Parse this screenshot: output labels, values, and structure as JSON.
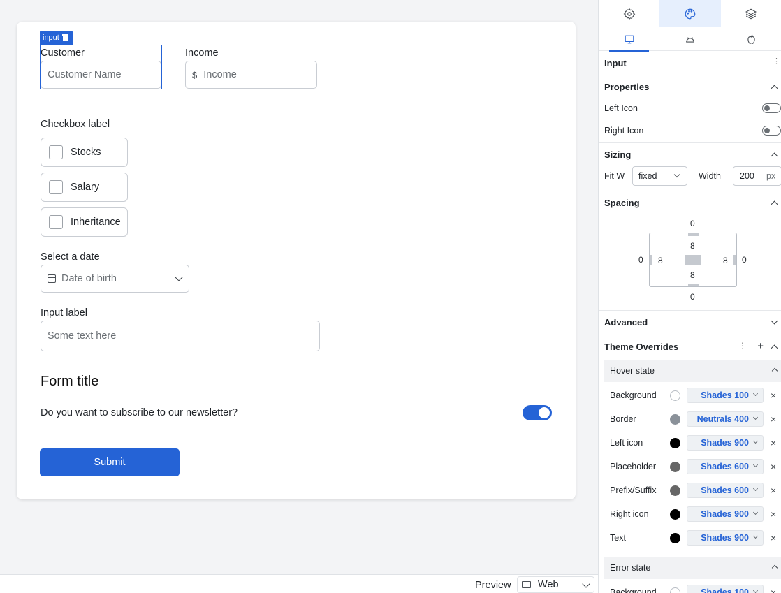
{
  "form": {
    "selection_tag": "input",
    "customer_label": "Customer",
    "customer_placeholder": "Customer Name",
    "income_label": "Income",
    "income_prefix": "$",
    "income_placeholder": "Income",
    "checkbox_group_label": "Checkbox label",
    "checkboxes": [
      {
        "label": "Stocks",
        "checked": false
      },
      {
        "label": "Salary",
        "checked": false
      },
      {
        "label": "Inheritance",
        "checked": false
      }
    ],
    "date_label": "Select a date",
    "date_placeholder": "Date of birth",
    "input_label": "Input label",
    "input_placeholder": "Some text here",
    "form_title": "Form title",
    "newsletter_question": "Do you want to subscribe to our newsletter?",
    "newsletter_on": true,
    "submit_label": "Submit"
  },
  "bottom_bar": {
    "preview_label": "Preview",
    "device": "Web"
  },
  "panel": {
    "top_tabs": [
      "settings-icon",
      "palette-icon",
      "layers-icon"
    ],
    "active_top_tab": 1,
    "device_tabs": [
      "desktop-icon",
      "android-icon",
      "apple-icon"
    ],
    "active_device_tab": 0,
    "component_name": "Input",
    "properties": {
      "title": "Properties",
      "left_icon_label": "Left Icon",
      "left_icon_on": false,
      "right_icon_label": "Right Icon",
      "right_icon_on": false
    },
    "sizing": {
      "title": "Sizing",
      "fit_label": "Fit W",
      "fit_value": "fixed",
      "width_label": "Width",
      "width_value": "200",
      "width_unit": "px"
    },
    "spacing": {
      "title": "Spacing",
      "margin_top": "0",
      "margin_right": "0",
      "margin_bottom": "0",
      "margin_left": "0",
      "padding_top": "8",
      "padding_right": "8",
      "padding_bottom": "8",
      "padding_left": "8"
    },
    "advanced_title": "Advanced",
    "theme_overrides_title": "Theme Overrides",
    "hover_state": {
      "title": "Hover state",
      "rows": [
        {
          "name": "Background",
          "color": "#ffffff",
          "value": "Shades 100"
        },
        {
          "name": "Border",
          "color": "#8a9199",
          "value": "Neutrals 400"
        },
        {
          "name": "Left icon",
          "color": "#000000",
          "value": "Shades 900"
        },
        {
          "name": "Placeholder",
          "color": "#666666",
          "value": "Shades 600"
        },
        {
          "name": "Prefix/Suffix",
          "color": "#666666",
          "value": "Shades 600"
        },
        {
          "name": "Right icon",
          "color": "#000000",
          "value": "Shades 900"
        },
        {
          "name": "Text",
          "color": "#000000",
          "value": "Shades 900"
        }
      ]
    },
    "error_state": {
      "title": "Error state",
      "rows": [
        {
          "name": "Background",
          "color": "#ffffff",
          "value": "Shades 100"
        }
      ]
    }
  },
  "colors": {
    "accent": "#2563d6",
    "active_tab_bg": "#e6effd"
  }
}
